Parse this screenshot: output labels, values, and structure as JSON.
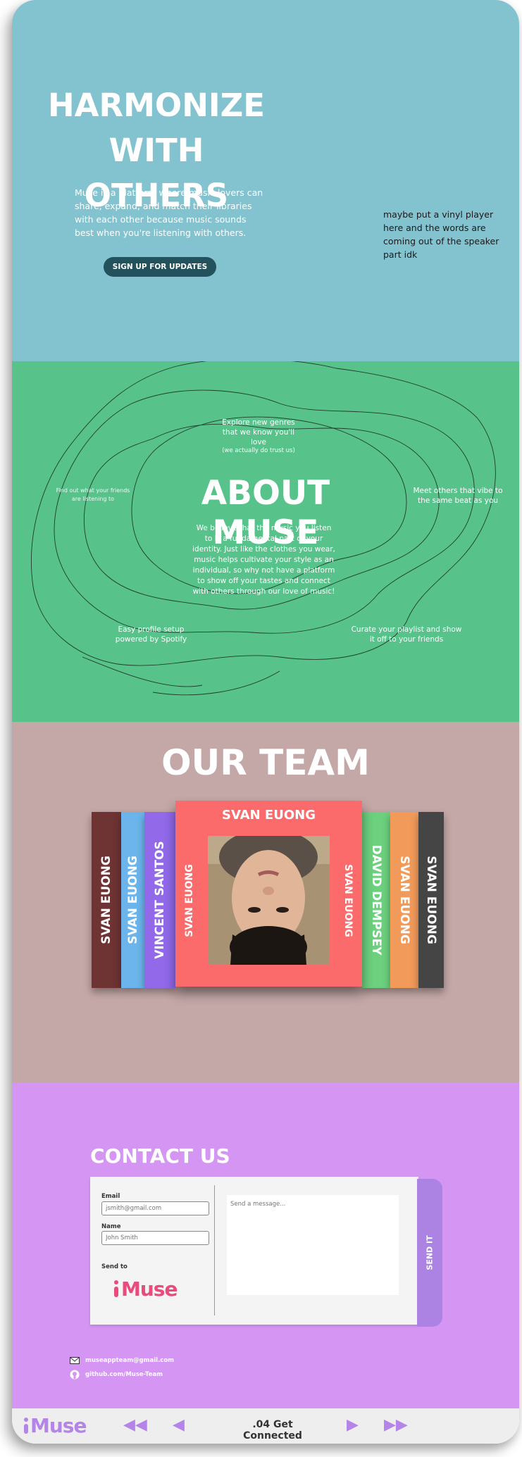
{
  "hero": {
    "title_line1": "HARMONIZE",
    "title_line2": "WITH OTHERS",
    "description": "Muse is a platform where music lovers can share, expand, and match their libraries with each other because music sounds best when you're listening with others.",
    "signup_label": "SIGN UP FOR UPDATES",
    "note": "maybe put a vinyl player here and the words are coming out of the speaker part idk"
  },
  "about": {
    "title": "ABOUT MUSE",
    "body": "We believe that the music you listen to is a fundamental part of your identity. Just like the clothes you wear, music helps cultivate your style as an individual, so why not have a platform to show off your tastes and connect with others through our love of music!",
    "features": {
      "explore": "Explore new genres that we know you'll love",
      "explore_note": "(we actually do trust us)",
      "find": "Find out what your friends are listening to",
      "meet": "Meet others that vibe to the same beat as you",
      "setup": "Easy profile setup powered by Spotify",
      "curate": "Curate your playlist and show it off to your friends"
    }
  },
  "team": {
    "title": "OUR TEAM",
    "cards_left": [
      "SVAN EUONG",
      "SVAN EUONG",
      "VINCENT SANTOS"
    ],
    "cards_right": [
      "DAVID DEMPSEY",
      "SVAN EUONG",
      "SVAN EUONG"
    ],
    "front": {
      "name": "SVAN EUONG",
      "side_left": "SVAN EUONG",
      "side_right": "SVAN EUONG"
    },
    "colors": {
      "c1": "#6e3333",
      "c2": "#6bb5ec",
      "c3": "#9169e9",
      "front": "#fb6b6b",
      "c4": "#6cd07e",
      "c5": "#f29a5a",
      "c6": "#454545"
    }
  },
  "contact": {
    "title": "CONTACT US",
    "email_label": "Email",
    "email_placeholder": "jsmith@gmail.com",
    "name_label": "Name",
    "name_placeholder": "John Smith",
    "send_to_label": "Send to",
    "logo": "Muse",
    "message_placeholder": "Send a message...",
    "send_label": "SEND IT",
    "email_link": "museappteam@gmail.com",
    "github_link": "github.com/Muse-Team"
  },
  "player": {
    "logo": "Muse",
    "track": ".04 Get Connected"
  }
}
